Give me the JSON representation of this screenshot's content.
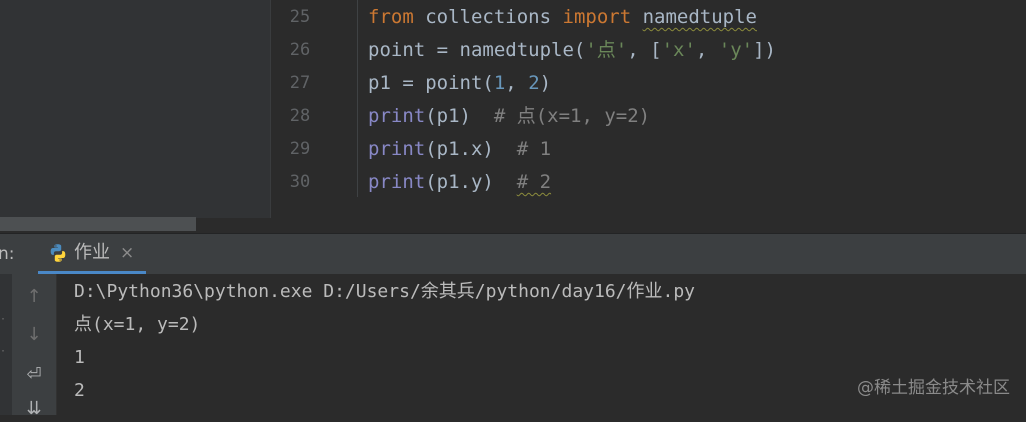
{
  "editor": {
    "lines": [
      {
        "num": "25",
        "tokens": [
          [
            "kw",
            "from"
          ],
          [
            "",
            "collections "
          ],
          [
            "kw",
            "import"
          ],
          [
            "",
            "namedtuple"
          ]
        ]
      },
      {
        "num": "26",
        "tokens": [
          [
            "",
            "point = namedtuple("
          ],
          [
            "str",
            "'点'"
          ],
          [
            "",
            ", ["
          ],
          [
            "str",
            "'x'"
          ],
          [
            "",
            ", "
          ],
          [
            "str",
            "'y'"
          ],
          [
            "",
            "])"
          ]
        ]
      },
      {
        "num": "27",
        "tokens": [
          [
            "",
            "p1 = point("
          ],
          [
            "num",
            "1"
          ],
          [
            "",
            ", "
          ],
          [
            "num",
            "2"
          ],
          [
            "",
            ")"
          ]
        ]
      },
      {
        "num": "28",
        "tokens": [
          [
            "fn",
            "print"
          ],
          [
            "",
            "(p1)  "
          ],
          [
            "cm",
            "# 点(x=1, y=2)"
          ]
        ]
      },
      {
        "num": "29",
        "tokens": [
          [
            "fn",
            "print"
          ],
          [
            "",
            "(p1.x)  "
          ],
          [
            "cm",
            "# 1"
          ]
        ]
      },
      {
        "num": "30",
        "tokens": [
          [
            "fn",
            "print"
          ],
          [
            "",
            "(p1.y)  "
          ],
          [
            "cm",
            "# 2"
          ]
        ]
      }
    ]
  },
  "run_panel": {
    "label": "n:",
    "tab_title": "作业",
    "tab_close": "×",
    "toolbar": {
      "up_icon": "↑",
      "down_icon": "↓",
      "wrap_icon": "⏎",
      "scroll_end_icon": "⇊"
    },
    "console": [
      "D:\\Python36\\python.exe D:/Users/余其兵/python/day16/作业.py",
      "点(x=1, y=2)",
      "1",
      "2"
    ]
  },
  "watermark": "@稀土掘金技术社区",
  "colors": {
    "editor_bg": "#2b2b2b",
    "panel_bg": "#3c3f41",
    "keyword": "#cc7832",
    "string": "#6a8759",
    "number": "#6897bb",
    "builtin": "#8888c6",
    "comment": "#808080",
    "tab_underline": "#4a88c7"
  }
}
